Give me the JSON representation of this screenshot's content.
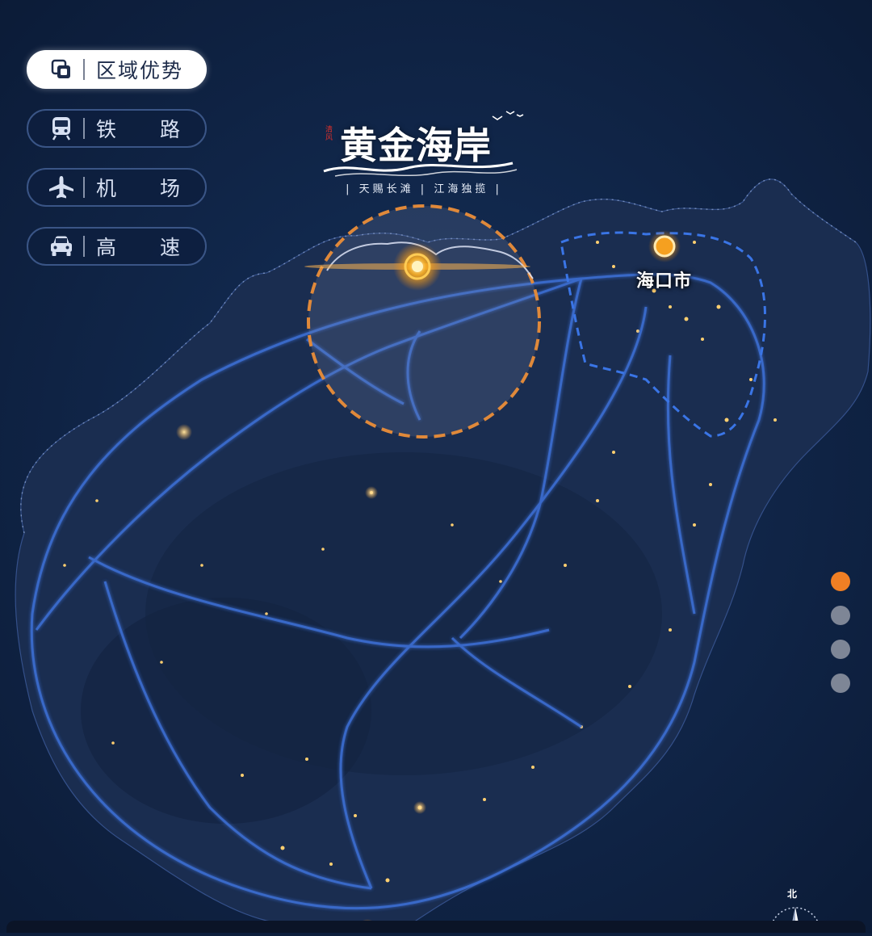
{
  "nav": {
    "items": [
      {
        "label": "区域优势",
        "icon": "layers-icon",
        "active": true
      },
      {
        "label": "铁路",
        "icon": "train-icon",
        "active": false
      },
      {
        "label": "机场",
        "icon": "airplane-icon",
        "active": false
      },
      {
        "label": "高速",
        "icon": "car-icon",
        "active": false
      }
    ]
  },
  "logo": {
    "title": "黄金海岸",
    "seal": "清风",
    "slogan": "| 天赐长滩 | 江海独揽 |"
  },
  "map": {
    "city_label": "海口市",
    "colors": {
      "sea": "#0e1f3d",
      "land": "#1a2c4e",
      "road": "#3c6fd6",
      "highlight_ring": "#e0893a",
      "city_marker": "#f5a020"
    }
  },
  "pager": {
    "count": 4,
    "active_index": 0,
    "active_color": "#f07f24",
    "inactive_color": "#7e8696"
  },
  "compass": {
    "label": "北"
  }
}
